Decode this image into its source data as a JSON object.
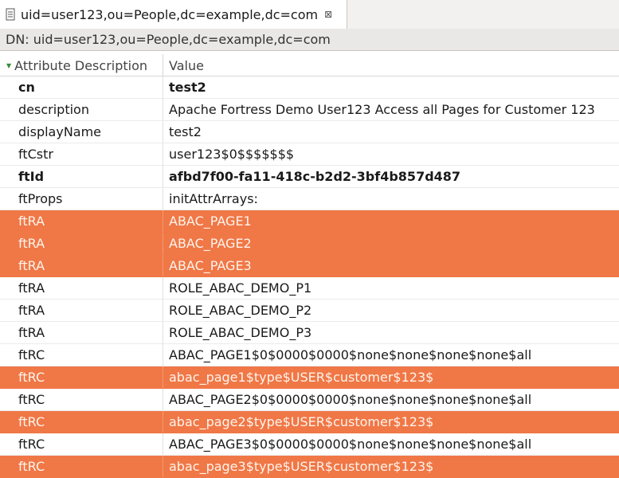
{
  "tab": {
    "icon": "document-icon",
    "title": "uid=user123,ou=People,dc=example,dc=com",
    "close_glyph": "⊠"
  },
  "dn_bar": {
    "text": "DN: uid=user123,ou=People,dc=example,dc=com"
  },
  "columns": {
    "attribute": "Attribute Description",
    "value": "Value"
  },
  "colors": {
    "selection": "#f07746"
  },
  "rows": [
    {
      "attr": "cn",
      "value": "test2",
      "bold": true,
      "selected": false
    },
    {
      "attr": "description",
      "value": "Apache Fortress Demo User123 Access all Pages for Customer 123",
      "bold": false,
      "selected": false
    },
    {
      "attr": "displayName",
      "value": "test2",
      "bold": false,
      "selected": false
    },
    {
      "attr": "ftCstr",
      "value": "user123$0$$$$$$$",
      "bold": false,
      "selected": false
    },
    {
      "attr": "ftId",
      "value": "afbd7f00-fa11-418c-b2d2-3bf4b857d487",
      "bold": true,
      "selected": false
    },
    {
      "attr": "ftProps",
      "value": "initAttrArrays:",
      "bold": false,
      "selected": false
    },
    {
      "attr": "ftRA",
      "value": "ABAC_PAGE1",
      "bold": false,
      "selected": true
    },
    {
      "attr": "ftRA",
      "value": "ABAC_PAGE2",
      "bold": false,
      "selected": true
    },
    {
      "attr": "ftRA",
      "value": "ABAC_PAGE3",
      "bold": false,
      "selected": true
    },
    {
      "attr": "ftRA",
      "value": "ROLE_ABAC_DEMO_P1",
      "bold": false,
      "selected": false
    },
    {
      "attr": "ftRA",
      "value": "ROLE_ABAC_DEMO_P2",
      "bold": false,
      "selected": false
    },
    {
      "attr": "ftRA",
      "value": "ROLE_ABAC_DEMO_P3",
      "bold": false,
      "selected": false
    },
    {
      "attr": "ftRC",
      "value": "ABAC_PAGE1$0$0000$0000$none$none$none$none$all",
      "bold": false,
      "selected": false
    },
    {
      "attr": "ftRC",
      "value": "abac_page1$type$USER$customer$123$",
      "bold": false,
      "selected": true
    },
    {
      "attr": "ftRC",
      "value": "ABAC_PAGE2$0$0000$0000$none$none$none$none$all",
      "bold": false,
      "selected": false
    },
    {
      "attr": "ftRC",
      "value": "abac_page2$type$USER$customer$123$",
      "bold": false,
      "selected": true
    },
    {
      "attr": "ftRC",
      "value": "ABAC_PAGE3$0$0000$0000$none$none$none$none$all",
      "bold": false,
      "selected": false
    },
    {
      "attr": "ftRC",
      "value": "abac_page3$type$USER$customer$123$",
      "bold": false,
      "selected": true
    }
  ]
}
